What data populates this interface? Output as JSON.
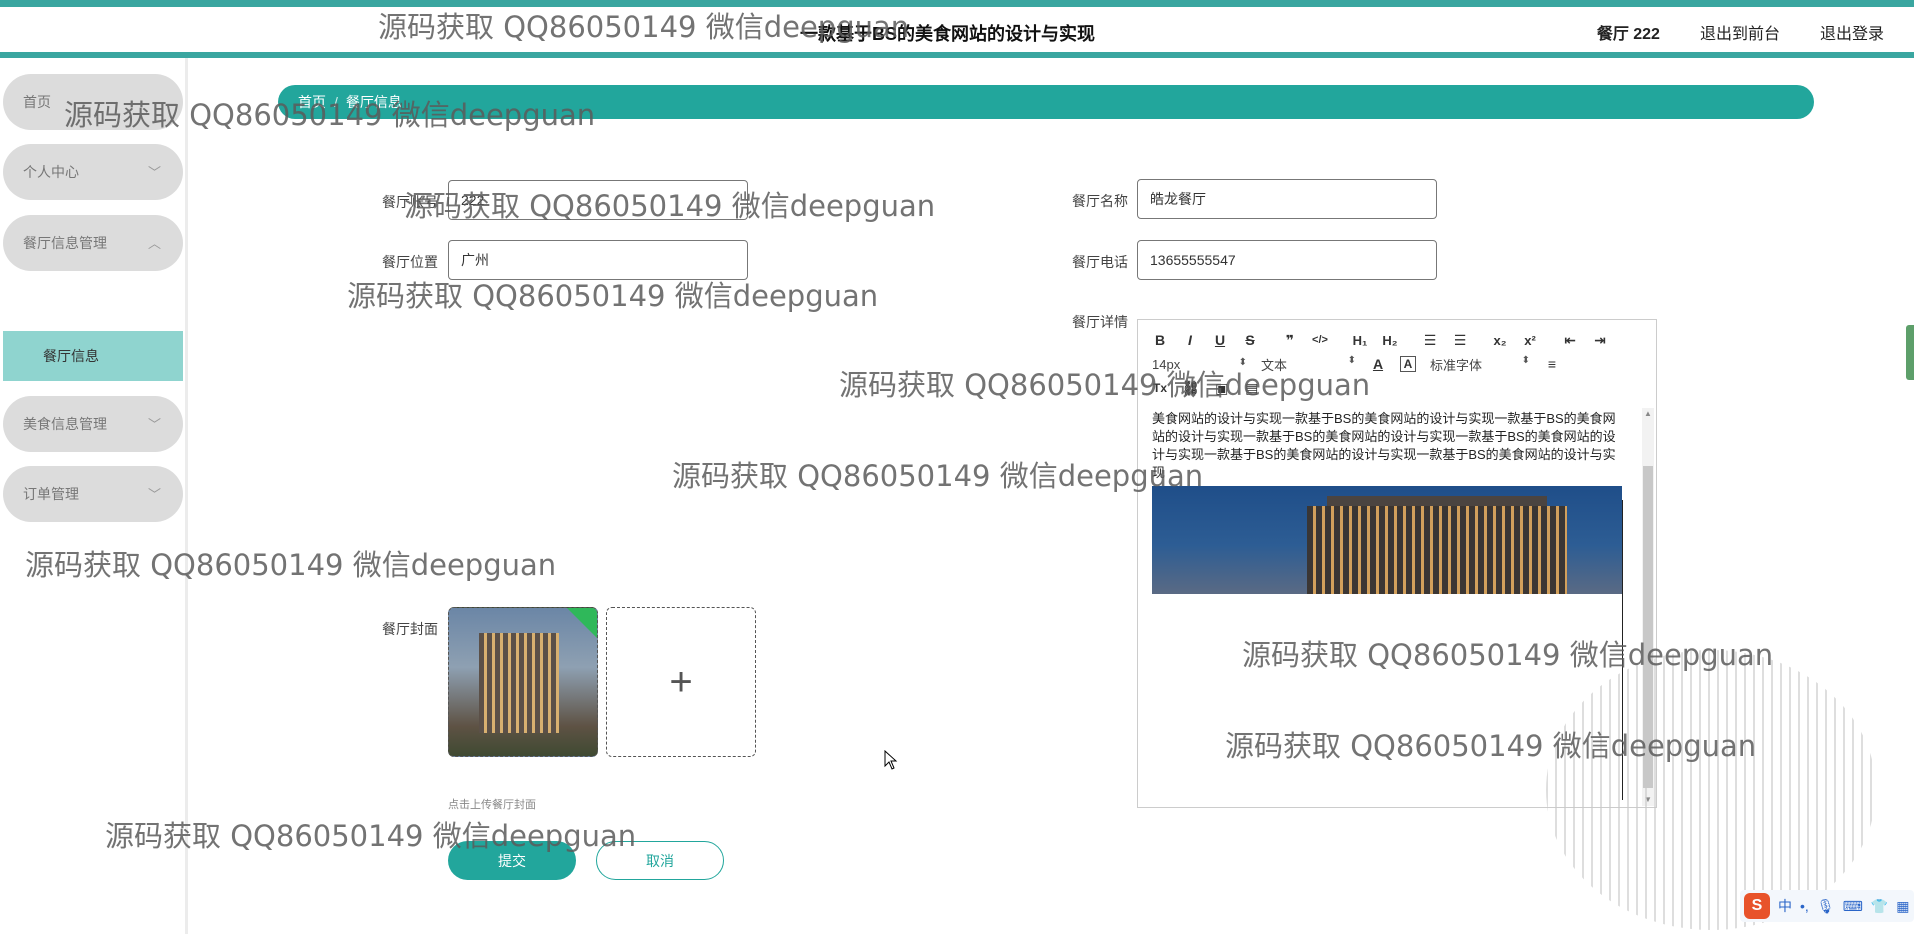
{
  "header": {
    "title": "一款基于BS的美食网站的设计与实现",
    "user": "餐厅 222",
    "nav_front": "退出到前台",
    "nav_logout": "退出登录"
  },
  "sidebar": {
    "items": [
      {
        "label": "首页"
      },
      {
        "label": "个人中心"
      },
      {
        "label": "餐厅信息管理"
      },
      {
        "label": "美食信息管理"
      },
      {
        "label": "订单管理"
      }
    ],
    "active_sub": "餐厅信息"
  },
  "breadcrumb": {
    "home": "首页",
    "separator": "/",
    "current": "餐厅信息"
  },
  "form": {
    "account_label": "餐厅账号",
    "account_value": "222",
    "name_label": "餐厅名称",
    "name_value": "皓龙餐厅",
    "location_label": "餐厅位置",
    "location_value": "广州",
    "phone_label": "餐厅电话",
    "phone_value": "13655555547",
    "details_label": "餐厅详情",
    "cover_label": "餐厅封面",
    "upload_hint": "点击上传餐厅封面",
    "submit_label": "提交",
    "cancel_label": "取消"
  },
  "editor": {
    "font_size": "14px",
    "text_type": "文本",
    "font_family": "标准字体",
    "content": "美食网站的设计与实现一款基于BS的美食网站的设计与实现一款基于BS的美食网站的设计与实现一款基于BS的美食网站的设计与实现一款基于BS的美食网站的设计与实现一款基于BS的美食网站的设计与实现一款基于BS的美食网站的设计与实现"
  },
  "watermark": "源码获取 QQ86050149 微信deepguan",
  "ime": {
    "lang": "中"
  },
  "colors": {
    "primary": "#22a69c",
    "sidebar_item": "#dcdcdc",
    "submenu_active": "#8fd4cf"
  }
}
